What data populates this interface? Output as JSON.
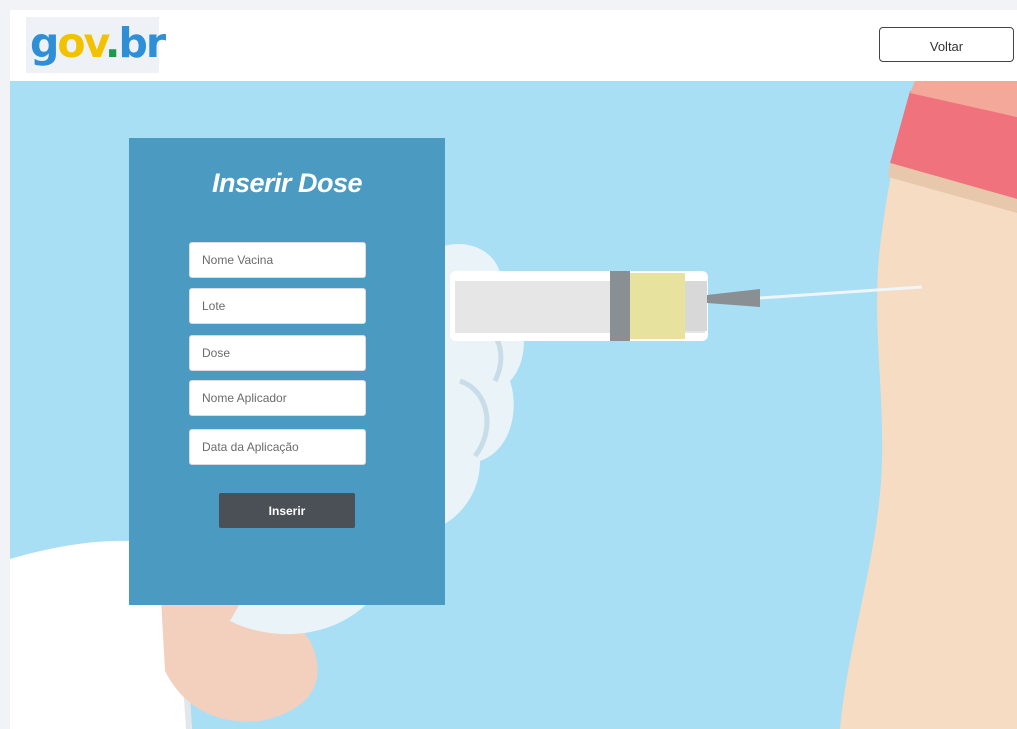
{
  "header": {
    "logo": {
      "g": "g",
      "ov": "ov",
      "dot": ".",
      "br": "br"
    },
    "back_label": "Voltar"
  },
  "form": {
    "title": "Inserir Dose",
    "fields": [
      {
        "placeholder": "Nome Vacina",
        "value": ""
      },
      {
        "placeholder": "Lote",
        "value": ""
      },
      {
        "placeholder": "Dose",
        "value": ""
      },
      {
        "placeholder": "Nome Aplicador",
        "value": ""
      },
      {
        "placeholder": "Data da Aplicação",
        "value": ""
      }
    ],
    "submit_label": "Inserir"
  },
  "colors": {
    "hero_background": "#a8dff5",
    "panel": "#4a9ac2",
    "submit_button": "#4b4f56",
    "logo_blue": "#2f8fd6",
    "logo_yellow": "#f2c200",
    "logo_green": "#1d9a4e"
  }
}
